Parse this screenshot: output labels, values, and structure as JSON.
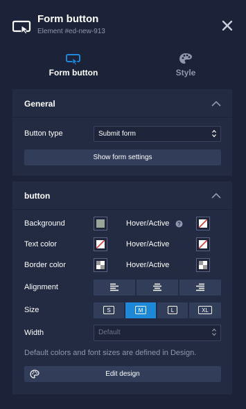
{
  "header": {
    "title": "Form button",
    "subtitle": "Element #ed-new-913",
    "icon": "form-button-icon",
    "close_icon": "close-icon"
  },
  "tabs": [
    {
      "label": "Form button",
      "icon": "form-button-icon",
      "active": true
    },
    {
      "label": "Style",
      "icon": "palette-icon",
      "active": false
    }
  ],
  "general": {
    "title": "General",
    "button_type_label": "Button type",
    "button_type_value": "Submit form",
    "show_settings_label": "Show form settings"
  },
  "button_section": {
    "title": "button",
    "rows": [
      {
        "label": "Background",
        "hover_label": "Hover/Active",
        "color": "gray",
        "hover_color": "none",
        "help": true
      },
      {
        "label": "Text color",
        "hover_label": "Hover/Active",
        "color": "none",
        "hover_color": "none",
        "help": false
      },
      {
        "label": "Border color",
        "hover_label": "Hover/Active",
        "color": "transparent",
        "hover_color": "transparent",
        "help": false
      }
    ],
    "alignment_label": "Alignment",
    "alignment_options": [
      "align-left-icon",
      "align-center-icon",
      "align-right-icon"
    ],
    "size_label": "Size",
    "size_options": [
      "S",
      "M",
      "L",
      "XL"
    ],
    "size_selected": "M",
    "width_label": "Width",
    "width_placeholder": "Default",
    "note": "Default colors and font sizes are defined in Design.",
    "edit_design_label": "Edit design"
  },
  "colors": {
    "background": "#1c2338",
    "section": "#232b43",
    "accent": "#1e88d8",
    "muted_text": "#8e97ad"
  }
}
